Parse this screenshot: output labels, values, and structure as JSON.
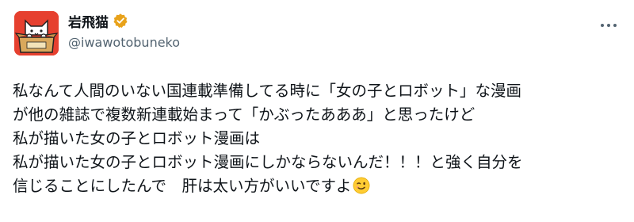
{
  "author": {
    "display_name": "岩飛猫",
    "handle": "@iwawotobuneko",
    "verified_badge_color": "#e8a21a",
    "avatar_bg_color": "#e6402f"
  },
  "menu_icon": "more-horizontal-icon",
  "post": {
    "lines": [
      "私なんて人間のいない国連載準備してる時に「女の子とロボット」な漫画",
      "が他の雑誌で複数新連載始まって「かぶったあああ」と思ったけど",
      "私が描いた女の子とロボット漫画は",
      "私が描いた女の子とロボット漫画にしかならないんだ！！！と強く自分を",
      "信じることにしたんで　肝は太い方がいいですよ"
    ],
    "trailing_emoji": "winking-face-emoji"
  }
}
